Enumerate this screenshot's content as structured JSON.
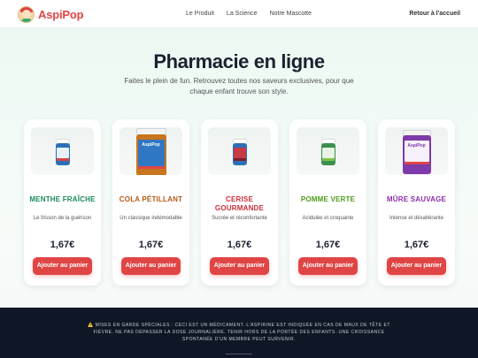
{
  "header": {
    "brand": "AspiPop",
    "nav": [
      "Le Produit",
      "La Science",
      "Notre Mascotte"
    ],
    "back_link": "Retour à l'accueil"
  },
  "hero": {
    "title": "Pharmacie en ligne",
    "subtitle": "Faites le plein de fun. Retrouvez toutes nos saveurs exclusives, pour que chaque enfant trouve son style."
  },
  "products": [
    {
      "name": "MENTHE FRAÎCHE",
      "desc": "Le frisson de la guérison",
      "price": "1,67€",
      "button": "Ajouter au panier",
      "color": "#1a8a5c"
    },
    {
      "name": "COLA PÉTILLANT",
      "desc": "Un classique indémodable",
      "price": "1,67€",
      "button": "Ajouter au panier",
      "color": "#b65a15"
    },
    {
      "name": "CERISE GOURMANDE",
      "desc": "Sucrée et réconfortante",
      "price": "1,67€",
      "button": "Ajouter au panier",
      "color": "#cc2f37"
    },
    {
      "name": "POMME VERTE",
      "desc": "Acidulée et croquante",
      "price": "1,67€",
      "button": "Ajouter au panier",
      "color": "#4e9c1d"
    },
    {
      "name": "MÛRE SAUVAGE",
      "desc": "Intense et désaltérante",
      "price": "1,67€",
      "button": "Ajouter au panier",
      "color": "#8a2fa7"
    }
  ],
  "product_images_label": "AspiPop",
  "footer": {
    "warning": "⚠️ Mises en garde spéciales : Ceci est un médicament. L'Aspirine est indiquée en cas de maux de tête et fièvre. Ne pas dépasser la dose journalière. Tenir hors de la portée des enfants. Une croissance spontanée d'un membre peut survenir."
  }
}
